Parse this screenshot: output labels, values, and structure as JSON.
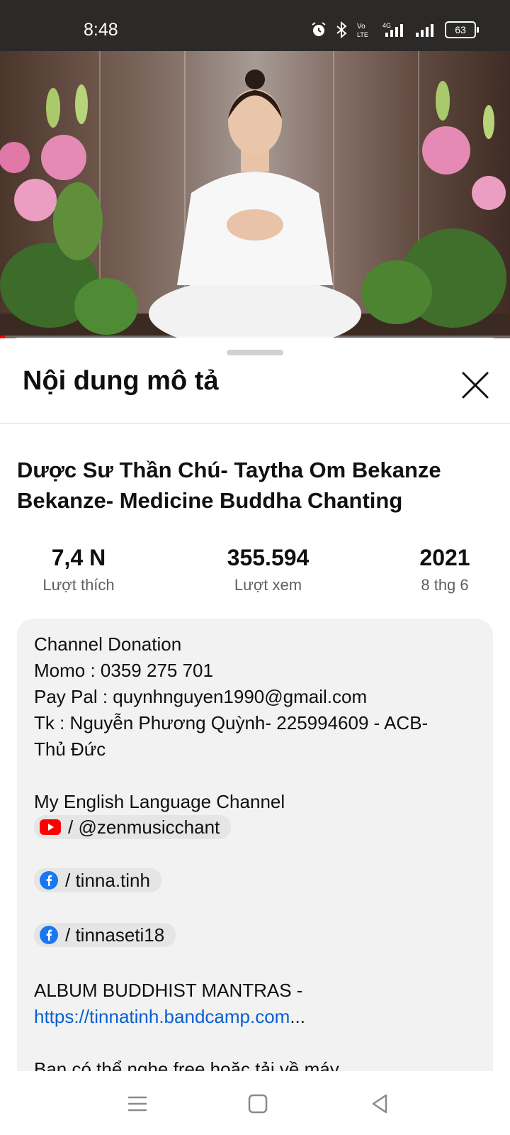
{
  "status_bar": {
    "time": "8:48",
    "battery": "63",
    "icons": [
      "alarm-icon",
      "bluetooth-icon",
      "volte-icon",
      "signal-4g-icon",
      "signal-icon",
      "battery-icon"
    ]
  },
  "video": {
    "progress_fraction": 0.01,
    "progress_color": "#ff0000"
  },
  "sheet": {
    "title": "Nội dung mô tả",
    "close_icon": "close-icon"
  },
  "video_info": {
    "title": "Dược Sư Thần Chú- Taytha Om Bekanze Bekanze- Medicine Buddha Chanting",
    "stats": [
      {
        "value": "7,4 N",
        "label": "Lượt thích"
      },
      {
        "value": "355.594",
        "label": "Lượt xem"
      },
      {
        "value": "2021",
        "label": "8 thg 6"
      }
    ]
  },
  "description": {
    "line1": "Channel Donation",
    "line2": "Momo : 0359 275 701",
    "line3": "Pay Pal : quynhnguyen1990@gmail.com",
    "line4": "Tk : Nguyễn Phương Quỳnh- 225994609 - ACB-",
    "line5": "Thủ Đức",
    "english_channel_label": "My English Language Channel",
    "youtube_chip": "/ @zenmusicchant",
    "facebook_chip_1": "/ tinna.tinh",
    "facebook_chip_2": "/ tinnaseti18",
    "album_label": "ALBUM BUDDHIST MANTRAS   -",
    "album_link": "https://tinnatinh.bandcamp.com",
    "album_ellipsis": "...",
    "last_line": "Bạn có thể nghe free hoặc tải về máy"
  },
  "colors": {
    "link": "#065fd4",
    "youtube_red": "#ff0000",
    "facebook_blue": "#1877f2"
  },
  "nav_bar": {
    "icons": [
      "menu-icon",
      "home-square-icon",
      "back-triangle-icon"
    ]
  }
}
